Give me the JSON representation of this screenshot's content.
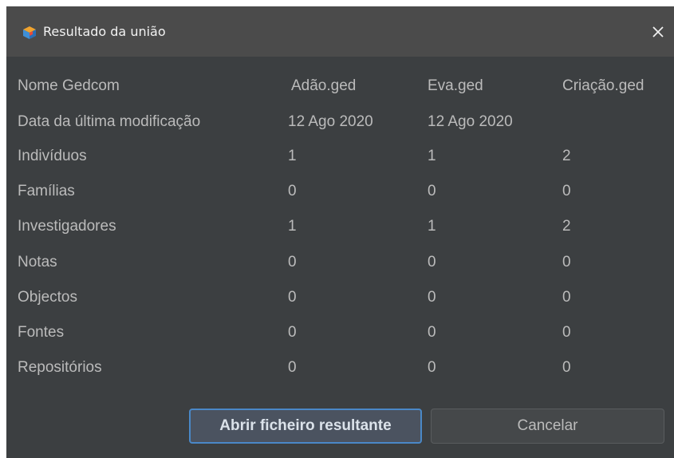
{
  "window": {
    "title": "Resultado da união"
  },
  "table": {
    "headers": [
      "Nome Gedcom",
      "Adão.ged",
      "Eva.ged",
      "Criação.ged"
    ],
    "rows": [
      {
        "label": "Data da última modificação",
        "values": [
          "12 Ago 2020",
          "12 Ago 2020",
          ""
        ]
      },
      {
        "label": "Indivíduos",
        "values": [
          "1",
          "1",
          "2"
        ]
      },
      {
        "label": "Famílias",
        "values": [
          "0",
          "0",
          "0"
        ]
      },
      {
        "label": "Investigadores",
        "values": [
          "1",
          "1",
          "2"
        ]
      },
      {
        "label": "Notas",
        "values": [
          "0",
          "0",
          "0"
        ]
      },
      {
        "label": "Objectos",
        "values": [
          "0",
          "0",
          "0"
        ]
      },
      {
        "label": "Fontes",
        "values": [
          "0",
          "0",
          "0"
        ]
      },
      {
        "label": "Repositórios",
        "values": [
          "0",
          "0",
          "0"
        ]
      }
    ]
  },
  "buttons": {
    "open_result": "Abrir ficheiro resultante",
    "cancel": "Cancelar"
  },
  "icons": {
    "app": "ancestris-cube-icon",
    "close": "close-icon"
  },
  "colors": {
    "background": "#3c3f41",
    "titlebar": "#4b4b4b",
    "text": "#bbbbbb",
    "primary_border": "#4a88c7"
  }
}
